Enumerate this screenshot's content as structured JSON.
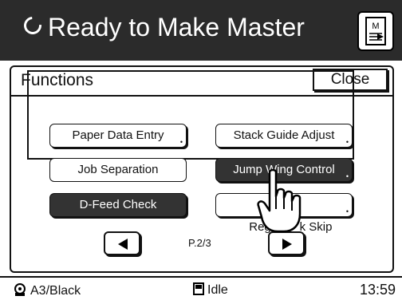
{
  "header": {
    "title": "Ready to Make Master",
    "status_icon": "spinner-icon",
    "master_button_icon": "master-document-icon"
  },
  "panel": {
    "title": "Functions",
    "close_label": "Close"
  },
  "functions": {
    "paper_data_entry": "Paper Data Entry",
    "stack_guide_adjust": "Stack Guide Adjust",
    "job_separation": "Job Separation",
    "jump_wing_control": "Jump Wing Control",
    "d_feed_check": "D-Feed Check",
    "register_mark_skip": "Regist     k Skip",
    "dark_color": "#333333"
  },
  "pager": {
    "page_indicator": "P.2/3",
    "prev_icon": "triangle-left-icon",
    "next_icon": "triangle-right-icon"
  },
  "statusbar": {
    "paper_info": "A3/Black",
    "machine_state": "Idle",
    "time": "13:59"
  }
}
